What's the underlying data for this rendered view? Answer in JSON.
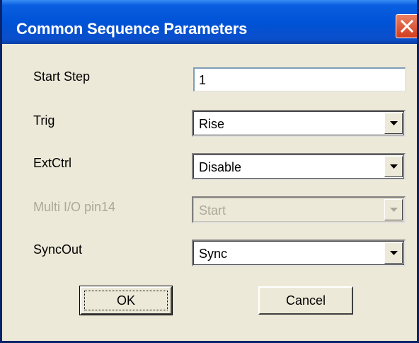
{
  "window": {
    "title": "Common Sequence Parameters"
  },
  "fields": {
    "start_step": {
      "label": "Start Step",
      "value": "1"
    },
    "trig": {
      "label": "Trig",
      "value": "Rise"
    },
    "extctrl": {
      "label": "ExtCtrl",
      "value": "Disable"
    },
    "multi_io": {
      "label": "Multi I/O pin14",
      "value": "Start",
      "disabled": true
    },
    "syncout": {
      "label": "SyncOut",
      "value": "Sync"
    }
  },
  "buttons": {
    "ok": "OK",
    "cancel": "Cancel"
  },
  "icons": {
    "close": "close-icon",
    "dropdown": "chevron-down-icon"
  },
  "colors": {
    "titlebar": "#0052d6",
    "close_button": "#d23c1d",
    "dialog_bg": "#ece9d8",
    "disabled_text": "#aca899"
  }
}
